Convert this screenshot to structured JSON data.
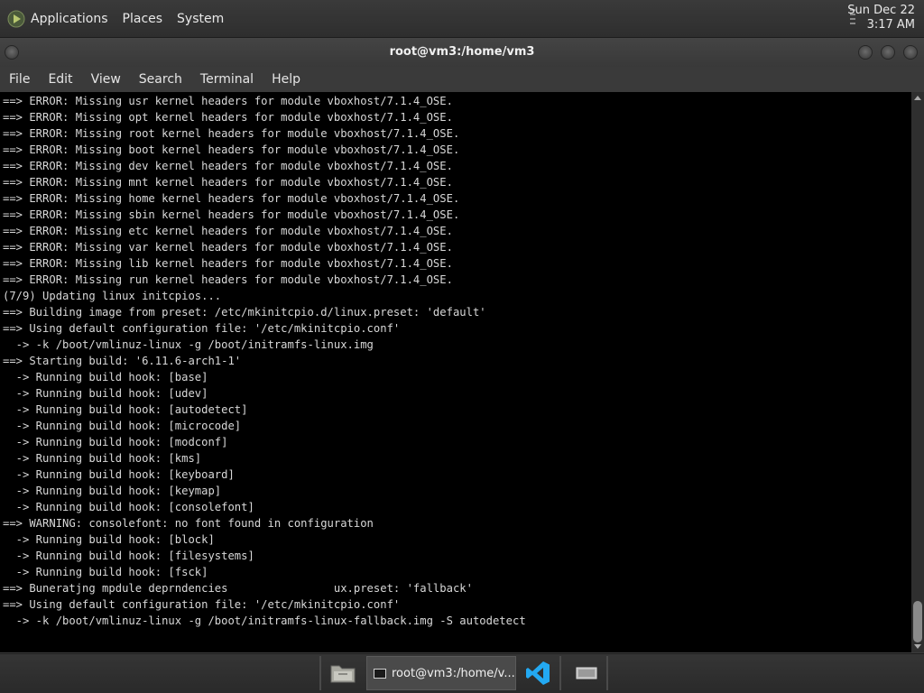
{
  "top_panel": {
    "menus": [
      "Applications",
      "Places",
      "System"
    ],
    "clock": {
      "date": "Sun Dec 22",
      "time": "3:17 AM"
    }
  },
  "window": {
    "title": "root@vm3:/home/vm3",
    "menubar": [
      "File",
      "Edit",
      "View",
      "Search",
      "Terminal",
      "Help"
    ]
  },
  "terminal": {
    "lines": [
      "==> ERROR: Missing usr kernel headers for module vboxhost/7.1.4_OSE.",
      "==> ERROR: Missing opt kernel headers for module vboxhost/7.1.4_OSE.",
      "==> ERROR: Missing root kernel headers for module vboxhost/7.1.4_OSE.",
      "==> ERROR: Missing boot kernel headers for module vboxhost/7.1.4_OSE.",
      "==> ERROR: Missing dev kernel headers for module vboxhost/7.1.4_OSE.",
      "==> ERROR: Missing mnt kernel headers for module vboxhost/7.1.4_OSE.",
      "==> ERROR: Missing home kernel headers for module vboxhost/7.1.4_OSE.",
      "==> ERROR: Missing sbin kernel headers for module vboxhost/7.1.4_OSE.",
      "==> ERROR: Missing etc kernel headers for module vboxhost/7.1.4_OSE.",
      "==> ERROR: Missing var kernel headers for module vboxhost/7.1.4_OSE.",
      "==> ERROR: Missing lib kernel headers for module vboxhost/7.1.4_OSE.",
      "==> ERROR: Missing run kernel headers for module vboxhost/7.1.4_OSE.",
      "(7/9) Updating linux initcpios...",
      "==> Building image from preset: /etc/mkinitcpio.d/linux.preset: 'default'",
      "==> Using default configuration file: '/etc/mkinitcpio.conf'",
      "  -> -k /boot/vmlinuz-linux -g /boot/initramfs-linux.img",
      "==> Starting build: '6.11.6-arch1-1'",
      "  -> Running build hook: [base]",
      "  -> Running build hook: [udev]",
      "  -> Running build hook: [autodetect]",
      "  -> Running build hook: [microcode]",
      "  -> Running build hook: [modconf]",
      "  -> Running build hook: [kms]",
      "  -> Running build hook: [keyboard]",
      "  -> Running build hook: [keymap]",
      "  -> Running build hook: [consolefont]",
      "==> WARNING: consolefont: no font found in configuration",
      "  -> Running build hook: [block]",
      "  -> Running build hook: [filesystems]",
      "  -> Running build hook: [fsck]",
      "==> Buneratjng mpdule deprndencies                ux.preset: 'fallback'",
      "==> Using default configuration file: '/etc/mkinitcpio.conf'",
      "  -> -k /boot/vmlinuz-linux -g /boot/initramfs-linux-fallback.img -S autodetect"
    ]
  },
  "taskbar": {
    "active_task": "root@vm3:/home/v..."
  },
  "colors": {
    "terminal_bg": "#000000",
    "terminal_fg": "#d8d8d8",
    "panel_bg": "#333333",
    "vscode_blue": "#23a9f2"
  }
}
